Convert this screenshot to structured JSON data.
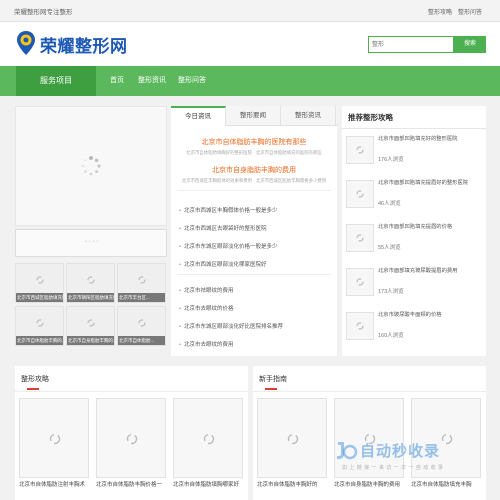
{
  "topbar": {
    "slogan": "荣耀整形网专注整形",
    "links": [
      "整形攻略",
      "整形问答"
    ]
  },
  "header": {
    "logo_text": "荣耀整形网",
    "search_placeholder": "整形",
    "search_button": "搜索"
  },
  "nav": {
    "category": "服务项目",
    "links": [
      "首页",
      "整形资讯",
      "整形问答"
    ]
  },
  "slider": {
    "bar_text": "• ○ • ○"
  },
  "thumbs": [
    "北京市西城区脂肪填充好的医院",
    "北京市朝阳区脂肪填充好的医院",
    "北京市丰台区...",
    "北京市自体脂肪丰胸的...",
    "北京市自身脂肪丰胸的...",
    "北京市自体脂肪..."
  ],
  "middle": {
    "tabs": [
      "今日资讯",
      "整形要闻",
      "整形资讯"
    ],
    "headline1": "北京市自体脂肪丰胸的医院有那些",
    "sub1": "北京市自体脂肪填胸好的整形医院 · 北京市自体脂肪填充的医院有那些",
    "headline2": "北京市自身脂肪丰胸的费用",
    "sub2": "北京市西城区丰胸假体的效果和费用 · 北京市西城区脂肪丰胸需要多少费用",
    "news_a": [
      "北京市西城区丰胸假体价格一般是多少",
      "北京市西城区去眼袋好的整形医院",
      "北京市东城区眼部淡化价格一般是多少",
      "北京市西城区眼部淡化哪家医院好"
    ],
    "news_b": [
      "北京市祛眼纹的费用",
      "北京市去眼纹的价格",
      "北京市东城区眼部淡化好比医院排名推荐",
      "北京市去眼纹的费用"
    ]
  },
  "right": {
    "title": "推荐整形攻略",
    "items": [
      {
        "text": "北京市面部凹陷填充好的整形医院",
        "views": "176人浏览"
      },
      {
        "text": "北京市面部凹陷填充提眉好的整形医院",
        "views": "46人浏览"
      },
      {
        "text": "北京市面部凹陷填充提眉的价格",
        "views": "55人浏览"
      },
      {
        "text": "北京市面部填充玻尿酸提眉的费用",
        "views": "173人浏览"
      },
      {
        "text": "北京市玻尿酸丰面颊的价格",
        "views": "160人浏览"
      }
    ]
  },
  "section1": {
    "title": "整形攻略",
    "captions": [
      "北京市自体脂肪注射丰胸术",
      "北京市自体脂肪丰胸价格一",
      "北京市自体脂肪填胸哪家好"
    ]
  },
  "section2": {
    "title": "新手指南",
    "captions": [
      "北京市自体脂肪丰胸好的",
      "北京市自身脂肪丰胸的费用",
      "北京市自体脂肪填充丰胸"
    ]
  },
  "watermark": {
    "text": "自动秒收录",
    "sub": "如 上 链 接 一 来 访 一 次 一 自 动 收 录"
  },
  "colors": {
    "brand_green": "#5cb85c",
    "logo_blue": "#1e58b5",
    "headline_orange": "#f06a1e"
  }
}
